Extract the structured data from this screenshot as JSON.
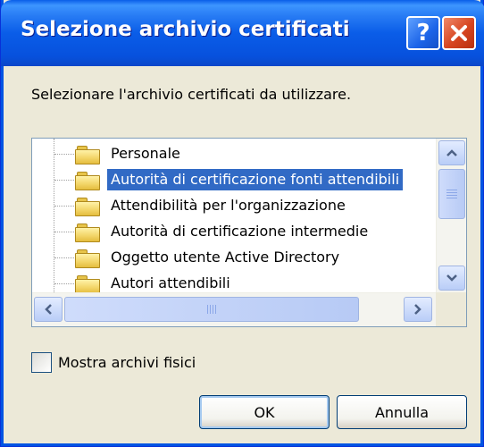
{
  "window": {
    "title": "Selezione archivio certificati",
    "help_button": "?",
    "close_button": "close"
  },
  "prompt": "Selezionare l'archivio certificati da utilizzare.",
  "tree": {
    "items": [
      {
        "label": "Personale",
        "selected": false
      },
      {
        "label": "Autorità di certificazione fonti attendibili",
        "selected": true
      },
      {
        "label": "Attendibilità per l'organizzazione",
        "selected": false
      },
      {
        "label": "Autorità di certificazione intermedie",
        "selected": false
      },
      {
        "label": "Oggetto utente Active Directory",
        "selected": false
      },
      {
        "label": "Autori attendibili",
        "selected": false
      }
    ],
    "icon": "folder-icon"
  },
  "checkbox": {
    "label": "Mostra archivi fisici",
    "checked": false
  },
  "buttons": {
    "ok": "OK",
    "cancel": "Annulla"
  },
  "colors": {
    "titlebar": "#0a5de8",
    "selection": "#316ac5",
    "window_bg": "#ece9d8",
    "close_button": "#d6441f"
  }
}
